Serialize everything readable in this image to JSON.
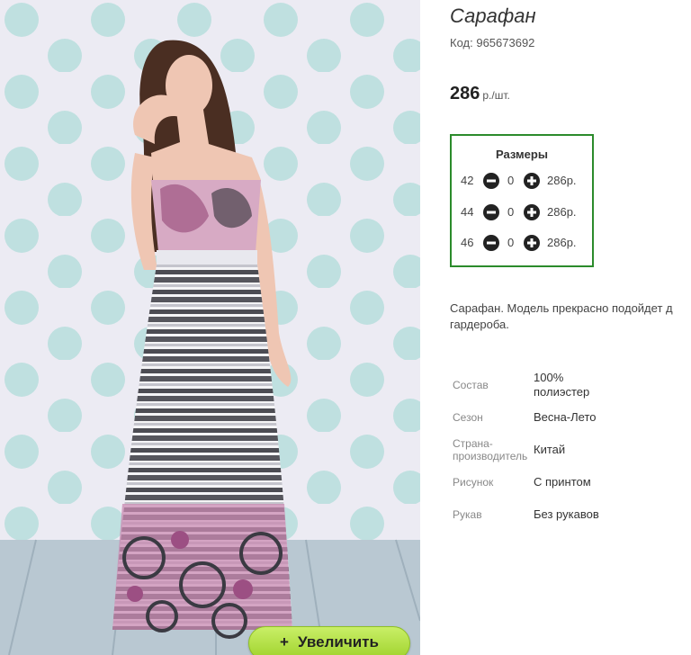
{
  "product": {
    "title": "Сарафан",
    "code_label": "Код:",
    "code_value": "965673692",
    "price_amount": "286",
    "price_unit": "р./шт."
  },
  "sizes": {
    "title": "Размеры",
    "rows": [
      {
        "size": "42",
        "qty": "0",
        "price": "286р."
      },
      {
        "size": "44",
        "qty": "0",
        "price": "286р."
      },
      {
        "size": "46",
        "qty": "0",
        "price": "286р."
      }
    ]
  },
  "description": {
    "line1": "Сарафан. Модель прекрасно подойдет д",
    "line2": "гардероба."
  },
  "attributes": [
    {
      "key": "Состав",
      "value": "100% полиэстер"
    },
    {
      "key": "Сезон",
      "value": "Весна-Лето"
    },
    {
      "key": "Страна-производитель",
      "value": "Китай"
    },
    {
      "key": "Рисунок",
      "value": "С принтом"
    },
    {
      "key": "Рукав",
      "value": "Без рукавов"
    }
  ],
  "zoom_button": {
    "plus": "+",
    "label": "Увеличить"
  },
  "colors": {
    "sizes_border": "#2b8b2b",
    "zoom_button": "#b3e04a",
    "polka_dot": "#bfe0e0",
    "wall": "#ecebf3"
  },
  "icons": [
    "minus-circle-icon",
    "plus-circle-icon"
  ]
}
